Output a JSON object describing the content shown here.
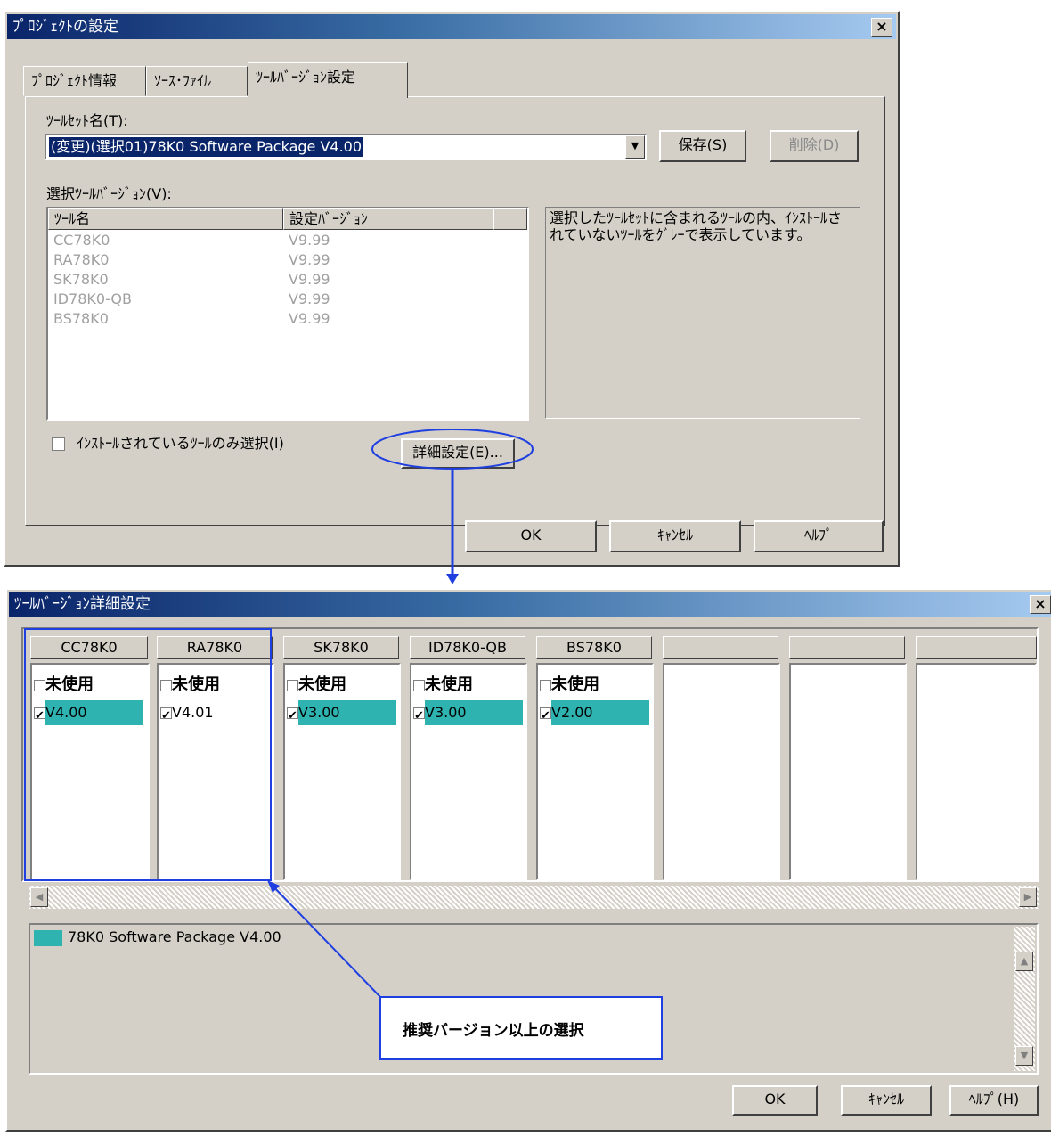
{
  "dialog1": {
    "title": "ﾌﾟﾛｼﾞｪｸﾄの設定",
    "close": "×",
    "tabs": [
      "ﾌﾟﾛｼﾞｪｸﾄ情報",
      "ｿｰｽ･ﾌｧｲﾙ",
      "ﾂｰﾙﾊﾞｰｼﾞｮﾝ設定"
    ],
    "toolset_label": "ﾂｰﾙｾｯﾄ名(T):",
    "toolset_value": "(変更)(選択01)78K0 Software Package V4.00",
    "save_button": "保存(S)",
    "delete_button": "削除(D)",
    "version_label": "選択ﾂｰﾙﾊﾞｰｼﾞｮﾝ(V):",
    "list_headers": [
      "ﾂｰﾙ名",
      "設定ﾊﾞｰｼﾞｮﾝ"
    ],
    "list_rows": [
      {
        "name": "CC78K0",
        "version": "V9.99"
      },
      {
        "name": "RA78K0",
        "version": "V9.99"
      },
      {
        "name": "SK78K0",
        "version": "V9.99"
      },
      {
        "name": "ID78K0-QB",
        "version": "V9.99"
      },
      {
        "name": "BS78K0",
        "version": "V9.99"
      }
    ],
    "info_text": "選択したﾂｰﾙｾｯﾄに含まれるﾂｰﾙの内、ｲﾝｽﾄｰﾙされていないﾂｰﾙをｸﾞﾚｰで表示しています。",
    "installed_only_checkbox": "ｲﾝｽﾄｰﾙされているﾂｰﾙのみ選択(I)",
    "detail_button": "詳細設定(E)...",
    "ok": "OK",
    "cancel": "ｷｬﾝｾﾙ",
    "help": "ﾍﾙﾌﾟ"
  },
  "dialog2": {
    "title": "ﾂｰﾙﾊﾞｰｼﾞｮﾝ詳細設定",
    "close": "×",
    "columns": [
      {
        "name": "CC78K0",
        "unused": "未使用",
        "version": "V4.00",
        "highlight": true
      },
      {
        "name": "RA78K0",
        "unused": "未使用",
        "version": "V4.01",
        "highlight": false
      },
      {
        "name": "SK78K0",
        "unused": "未使用",
        "version": "V3.00",
        "highlight": true
      },
      {
        "name": "ID78K0-QB",
        "unused": "未使用",
        "version": "V3.00",
        "highlight": true
      },
      {
        "name": "BS78K0",
        "unused": "未使用",
        "version": "V2.00",
        "highlight": true
      },
      {
        "name": "",
        "unused": "",
        "version": "",
        "highlight": false
      },
      {
        "name": "",
        "unused": "",
        "version": "",
        "highlight": false
      },
      {
        "name": "",
        "unused": "",
        "version": "",
        "highlight": false
      }
    ],
    "legend_text": "78K0 Software Package V4.00",
    "ok": "OK",
    "cancel": "ｷｬﾝｾﾙ",
    "help": "ﾍﾙﾌﾟ(H)"
  },
  "annotation": {
    "callout_text": "推奨バージョン以上の選択"
  },
  "colors": {
    "highlight": "#2fb3b0",
    "annotation_blue": "#1f3fe0",
    "dialog_face": "#d4d0c8"
  }
}
